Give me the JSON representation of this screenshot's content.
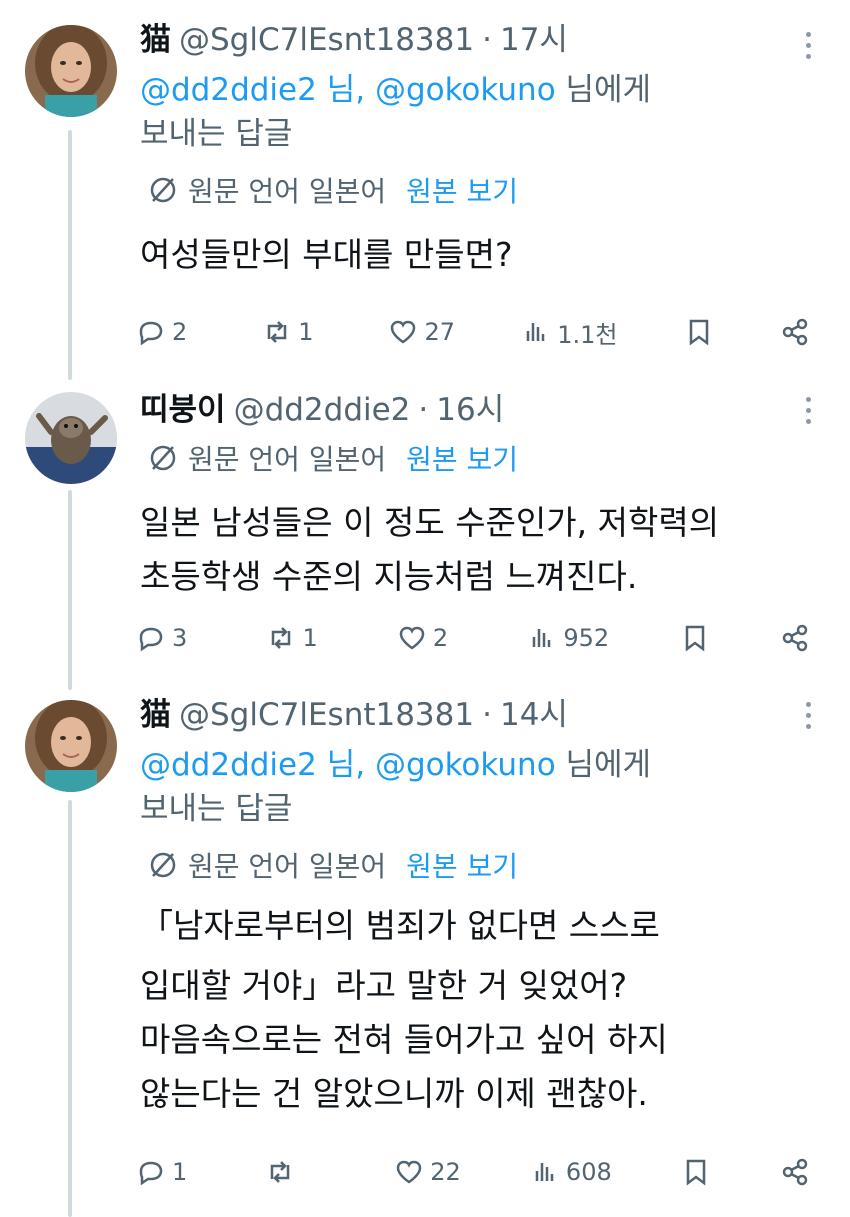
{
  "tweets": [
    {
      "display_name": "猫",
      "handle": "@SglC7lEsnt18381",
      "time": "17시",
      "reply_to": {
        "mention1": "@dd2ddie2 님,",
        "mention2": "@gokokuno",
        "suffix1": " 님에게",
        "suffix2": "보내는 답글"
      },
      "translation": {
        "label": "원문 언어 일본어",
        "link": "원본 보기"
      },
      "text_lines": [
        "여성들만의 부대를 만들면?"
      ],
      "stats": {
        "replies": "2",
        "retweets": "1",
        "likes": "27",
        "views": "1.1천"
      }
    },
    {
      "display_name": "띠붕이",
      "handle": "@dd2ddie2",
      "time": "16시",
      "translation": {
        "label": "원문 언어 일본어",
        "link": "원본 보기"
      },
      "text_lines": [
        "일본 남성들은 이 정도 수준인가, 저학력의",
        "초등학생 수준의 지능처럼 느껴진다."
      ],
      "stats": {
        "replies": "3",
        "retweets": "1",
        "likes": "2",
        "views": "952"
      }
    },
    {
      "display_name": "猫",
      "handle": "@SglC7lEsnt18381",
      "time": "14시",
      "reply_to": {
        "mention1": "@dd2ddie2 님,",
        "mention2": "@gokokuno",
        "suffix1": " 님에게",
        "suffix2": "보내는 답글"
      },
      "translation": {
        "label": "원문 언어 일본어",
        "link": "원본 보기"
      },
      "text_lines": [
        "「남자로부터의 범죄가 없다면 스스로",
        "입대할 거야」라고 말한 거 잊었어?",
        "마음속으로는 전혀 들어가고 싶어 하지",
        "않는다는 건 알았으니까 이제 괜찮아."
      ],
      "stats": {
        "replies": "1",
        "retweets": "",
        "likes": "22",
        "views": "608"
      }
    }
  ],
  "icons": [
    "globe-icon",
    "reply-icon",
    "retweet-icon",
    "like-icon",
    "views-icon",
    "bookmark-icon",
    "share-icon",
    "more-icon"
  ],
  "colors": {
    "link": "#1d9bf0",
    "muted": "#536471",
    "thread_line": "#cfd9de"
  }
}
